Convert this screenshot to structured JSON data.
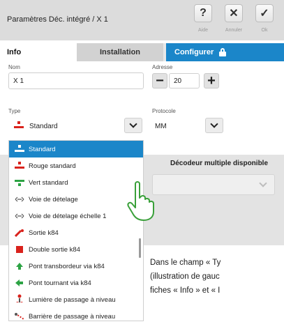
{
  "header": {
    "title": "Paramètres Déc. intégré / X 1",
    "buttons": [
      {
        "symbol": "?",
        "label": "Aide"
      },
      {
        "symbol": "✕",
        "label": "Annuler"
      },
      {
        "symbol": "✓",
        "label": "Ok"
      }
    ]
  },
  "tabs": [
    "Info",
    "Installation",
    "Configurer"
  ],
  "form": {
    "nom_label": "Nom",
    "nom_value": "X 1",
    "adresse_label": "Adresse",
    "adresse_value": "20",
    "type_label": "Type",
    "type_value": "Standard",
    "protocole_label": "Protocole",
    "protocole_value": "MM",
    "multi_label": "Décodeur multiple disponible"
  },
  "type_options": [
    {
      "label": "Standard",
      "icon": "red-signal-icon",
      "selected": true
    },
    {
      "label": "Rouge standard",
      "icon": "red-signal-icon",
      "selected": false
    },
    {
      "label": "Vert standard",
      "icon": "green-signal-icon",
      "selected": false
    },
    {
      "label": "Voie de dételage",
      "icon": "uncoupling-icon",
      "selected": false
    },
    {
      "label": "Voie de dételage échelle 1",
      "icon": "uncoupling-icon",
      "selected": false
    },
    {
      "label": "Sortie k84",
      "icon": "k84-output-icon",
      "selected": false
    },
    {
      "label": "Double sortie k84",
      "icon": "red-square-icon",
      "selected": false
    },
    {
      "label": "Pont transbordeur via k84",
      "icon": "green-arrow-up-icon",
      "selected": false
    },
    {
      "label": "Pont tournant via k84",
      "icon": "green-arrow-left-icon",
      "selected": false
    },
    {
      "label": "Lumière de passage à niveau",
      "icon": "crossing-light-icon",
      "selected": false
    },
    {
      "label": "Barrière de passage à niveau",
      "icon": "barrier-icon",
      "selected": false
    }
  ],
  "caption": {
    "line1": "Dans le champ « Ty",
    "line2": "(illustration de gauc",
    "line3": "fiches « Info » et « I"
  },
  "colors": {
    "accent": "#1b86c9",
    "red": "#d9221c",
    "green": "#2ca344"
  }
}
